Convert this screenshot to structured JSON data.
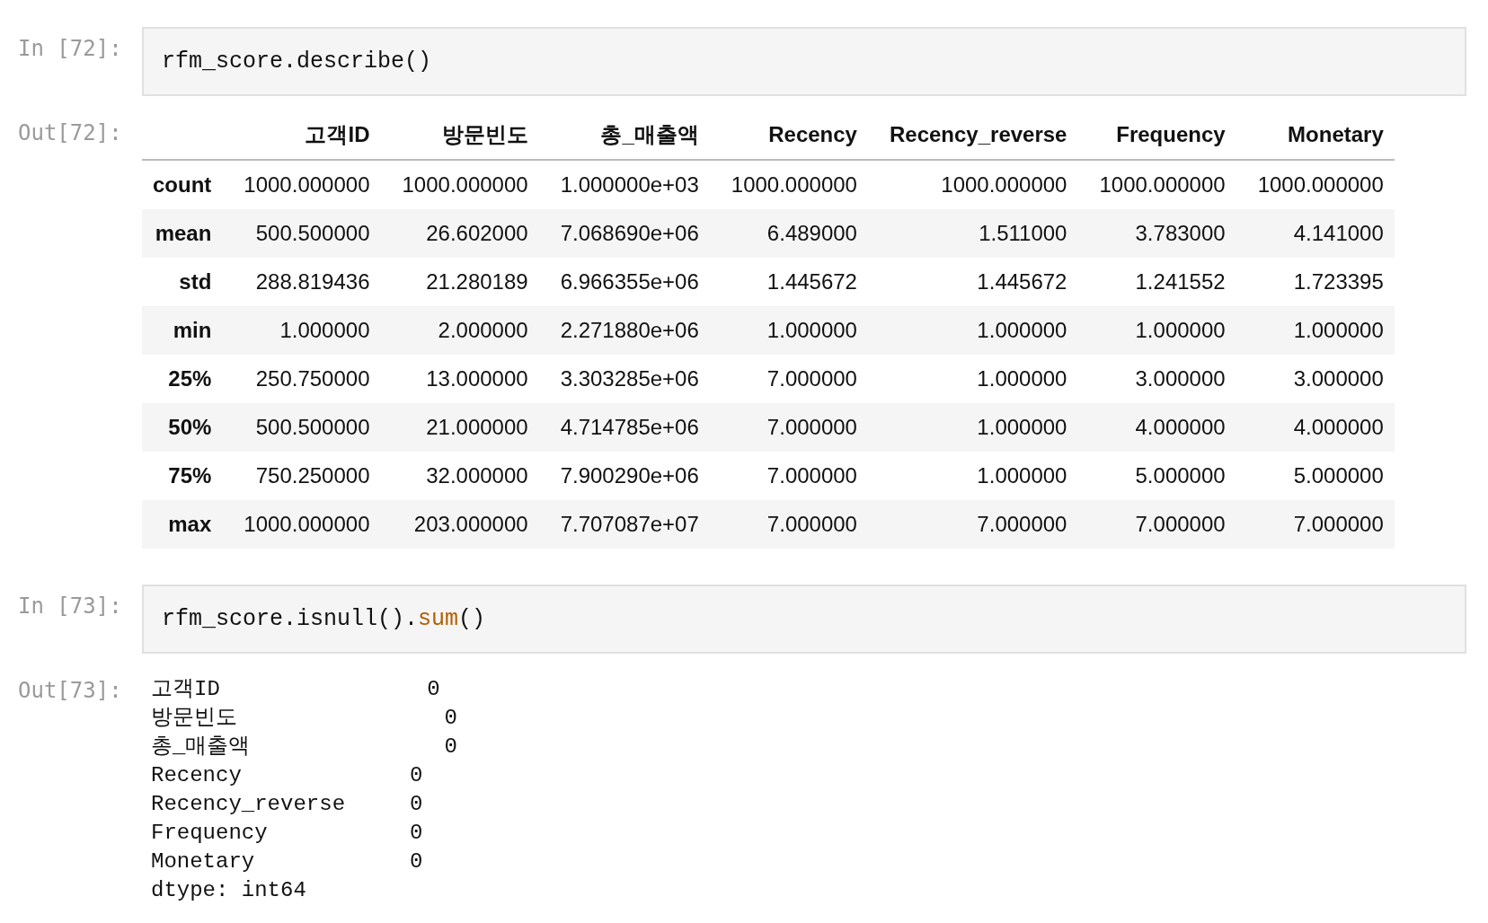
{
  "cells": [
    {
      "in_prompt": "In [72]:",
      "code": [
        {
          "text": "rfm_score.describe()",
          "kind": "plain"
        }
      ],
      "out_prompt": "Out[72]:",
      "table": {
        "columns": [
          "고객ID",
          "방문빈도",
          "총_매출액",
          "Recency",
          "Recency_reverse",
          "Frequency",
          "Monetary"
        ],
        "rows": [
          {
            "label": "count",
            "cells": [
              "1000.000000",
              "1000.000000",
              "1.000000e+03",
              "1000.000000",
              "1000.000000",
              "1000.000000",
              "1000.000000"
            ]
          },
          {
            "label": "mean",
            "cells": [
              "500.500000",
              "26.602000",
              "7.068690e+06",
              "6.489000",
              "1.511000",
              "3.783000",
              "4.141000"
            ]
          },
          {
            "label": "std",
            "cells": [
              "288.819436",
              "21.280189",
              "6.966355e+06",
              "1.445672",
              "1.445672",
              "1.241552",
              "1.723395"
            ]
          },
          {
            "label": "min",
            "cells": [
              "1.000000",
              "2.000000",
              "2.271880e+06",
              "1.000000",
              "1.000000",
              "1.000000",
              "1.000000"
            ]
          },
          {
            "label": "25%",
            "cells": [
              "250.750000",
              "13.000000",
              "3.303285e+06",
              "7.000000",
              "1.000000",
              "3.000000",
              "3.000000"
            ]
          },
          {
            "label": "50%",
            "cells": [
              "500.500000",
              "21.000000",
              "4.714785e+06",
              "7.000000",
              "1.000000",
              "4.000000",
              "4.000000"
            ]
          },
          {
            "label": "75%",
            "cells": [
              "750.250000",
              "32.000000",
              "7.900290e+06",
              "7.000000",
              "1.000000",
              "5.000000",
              "5.000000"
            ]
          },
          {
            "label": "max",
            "cells": [
              "1000.000000",
              "203.000000",
              "7.707087e+07",
              "7.000000",
              "7.000000",
              "7.000000",
              "7.000000"
            ]
          }
        ]
      }
    },
    {
      "in_prompt": "In [73]:",
      "code": [
        {
          "text": "rfm_score.isnull().",
          "kind": "plain"
        },
        {
          "text": "sum",
          "kind": "builtin"
        },
        {
          "text": "()",
          "kind": "plain"
        }
      ],
      "out_prompt": "Out[73]:",
      "lines": [
        "고객ID                0",
        "방문빈도                0",
        "총_매출액               0",
        "Recency             0",
        "Recency_reverse     0",
        "Frequency           0",
        "Monetary            0",
        "dtype: int64"
      ]
    }
  ]
}
